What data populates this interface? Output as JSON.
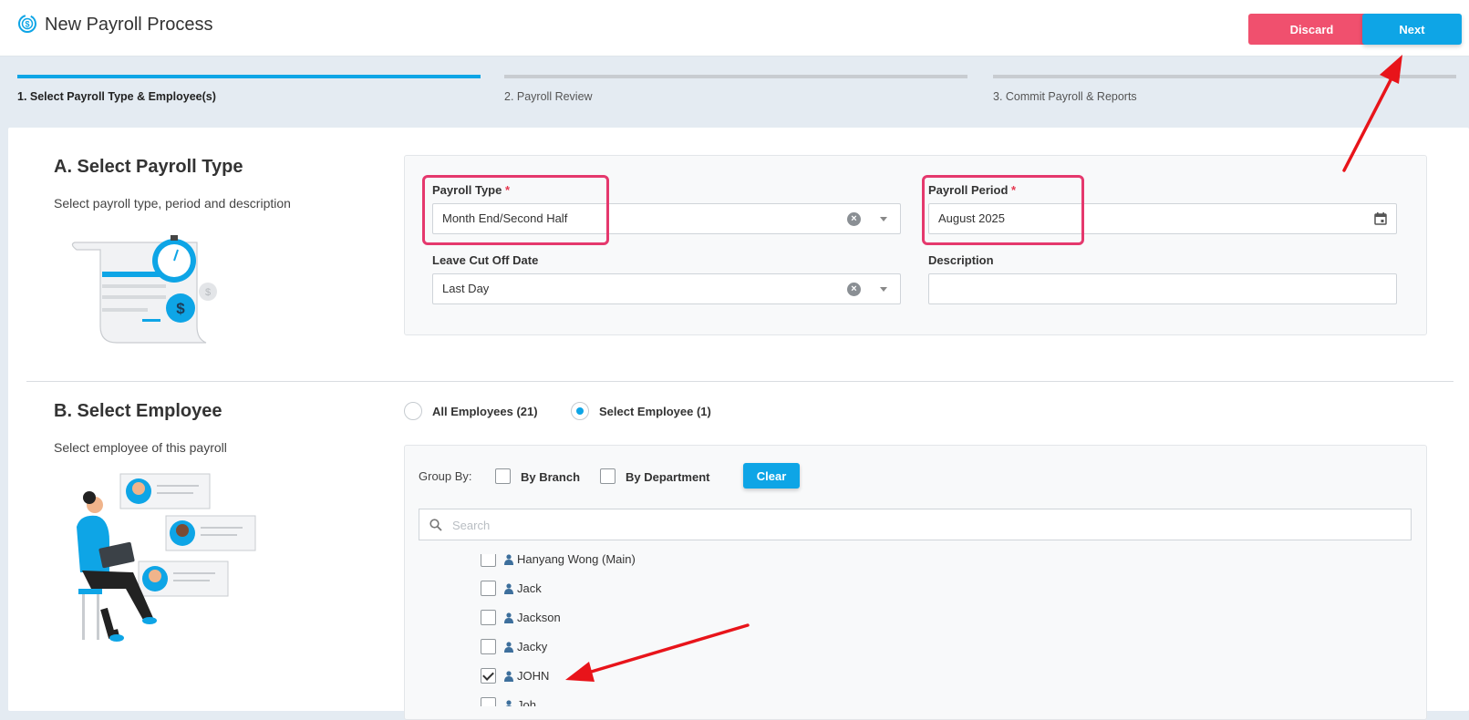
{
  "header": {
    "title": "New Payroll Process",
    "discard_label": "Discard",
    "next_label": "Next"
  },
  "steps": [
    {
      "label": "1. Select Payroll Type & Employee(s)",
      "active": true
    },
    {
      "label": "2. Payroll Review",
      "active": false
    },
    {
      "label": "3. Commit Payroll & Reports",
      "active": false
    }
  ],
  "section_a": {
    "title": "A. Select Payroll Type",
    "subtitle": "Select payroll type, period and description",
    "payroll_type_label": "Payroll Type",
    "payroll_type_value": "Month End/Second Half",
    "payroll_period_label": "Payroll Period",
    "payroll_period_value": "August 2025",
    "leave_cutoff_label": "Leave Cut Off Date",
    "leave_cutoff_value": "Last Day",
    "description_label": "Description",
    "description_value": "",
    "required_mark": "*"
  },
  "section_b": {
    "title": "B. Select Employee",
    "subtitle": "Select employee of this payroll",
    "all_employees_label": "All Employees (21)",
    "select_employee_label": "Select Employee (1)",
    "selected_mode": "select",
    "group_by_label": "Group By:",
    "by_branch_label": "By Branch",
    "by_department_label": "By Department",
    "clear_label": "Clear",
    "search_placeholder": "Search",
    "employees": [
      {
        "name": "Hanyang Wong (Main)",
        "checked": false
      },
      {
        "name": "Jack",
        "checked": false
      },
      {
        "name": "Jackson",
        "checked": false
      },
      {
        "name": "Jacky",
        "checked": false
      },
      {
        "name": "JOHN",
        "checked": true
      },
      {
        "name": "Joh",
        "checked": false
      }
    ]
  },
  "colors": {
    "accent": "#0ea5e6",
    "discard": "#f0506e",
    "highlight": "#e5386d",
    "annotation_arrow": "#e8141a"
  }
}
